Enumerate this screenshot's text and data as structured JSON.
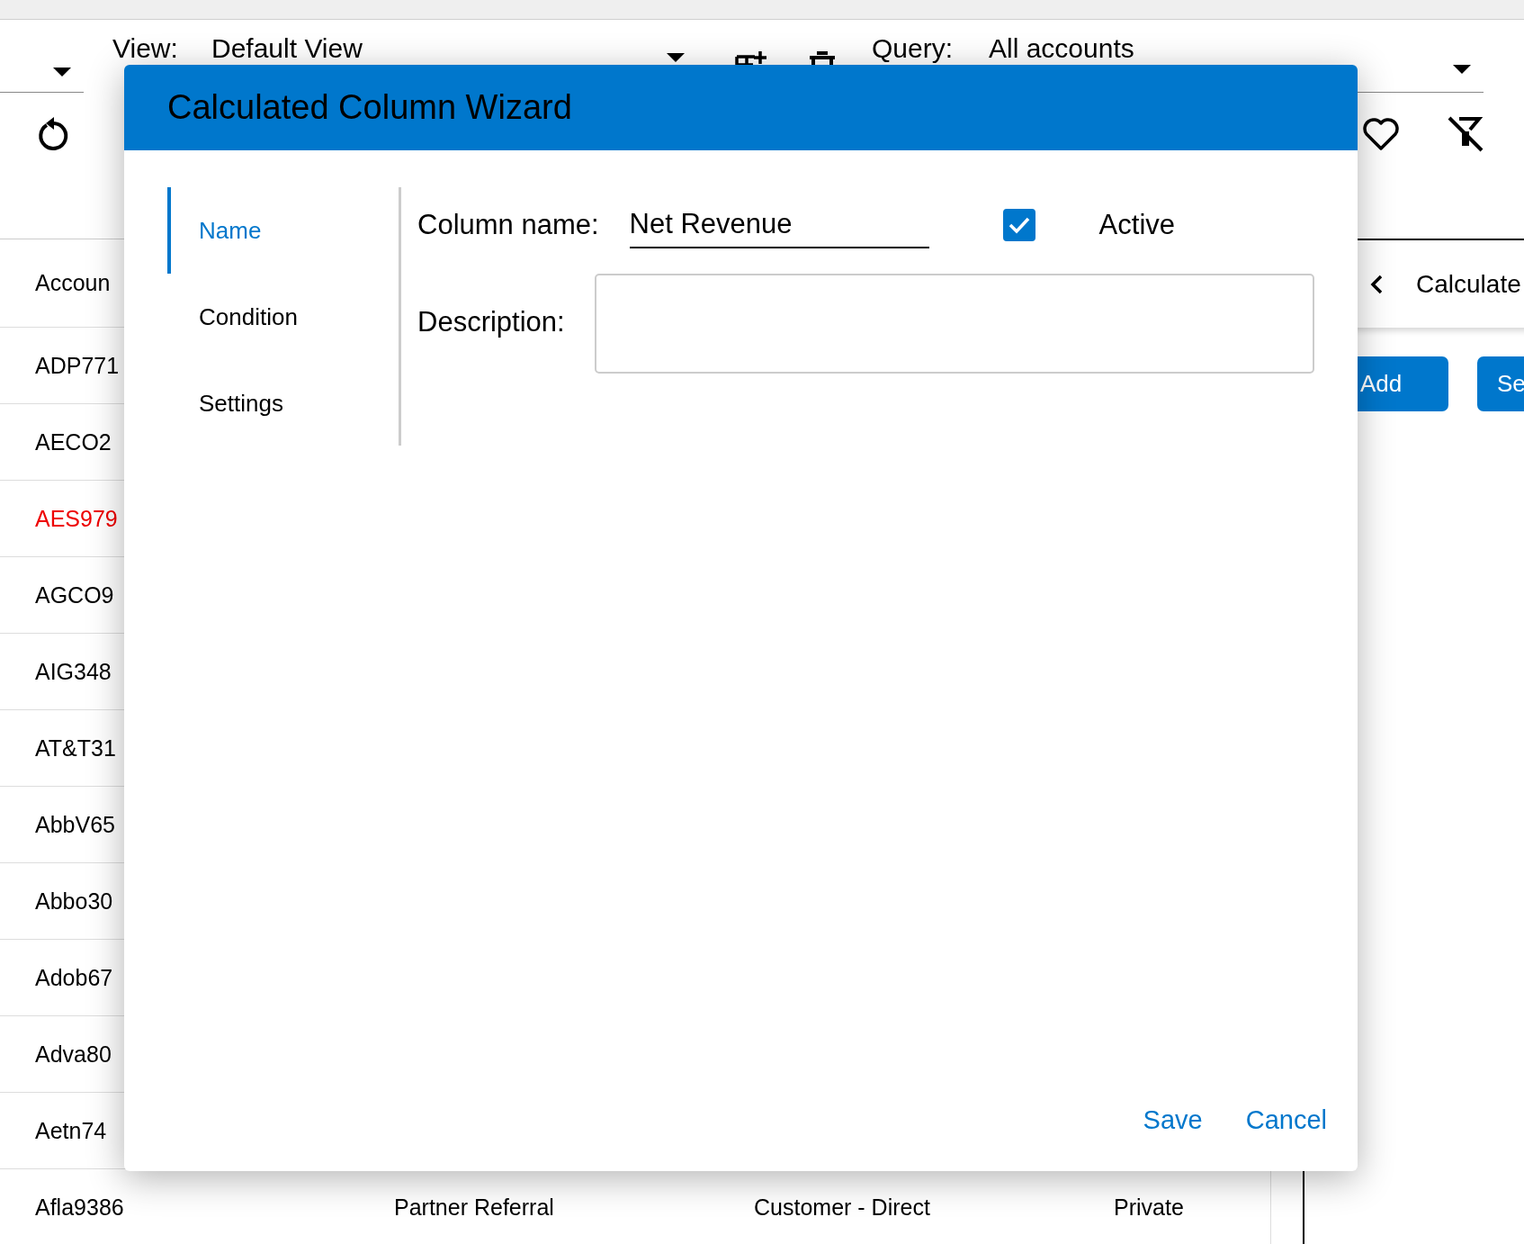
{
  "toolbar": {
    "view_label": "View:",
    "view_value": "Default View",
    "query_label": "Query:",
    "query_value": "All accounts"
  },
  "table": {
    "columns": [
      "Accoun"
    ],
    "rows": [
      {
        "cells": [
          "ADP771"
        ],
        "color": "#000000"
      },
      {
        "cells": [
          "AECO2"
        ],
        "color": "#000000"
      },
      {
        "cells": [
          "AES979"
        ],
        "color": "#ee0000"
      },
      {
        "cells": [
          "AGCO9"
        ],
        "color": "#000000"
      },
      {
        "cells": [
          "AIG348"
        ],
        "color": "#000000"
      },
      {
        "cells": [
          "AT&T31"
        ],
        "color": "#000000"
      },
      {
        "cells": [
          "AbbV65"
        ],
        "color": "#000000"
      },
      {
        "cells": [
          "Abbo30"
        ],
        "color": "#000000"
      },
      {
        "cells": [
          "Adob67"
        ],
        "color": "#000000"
      },
      {
        "cells": [
          "Adva80"
        ],
        "color": "#000000"
      },
      {
        "cells": [
          "Aetn74"
        ],
        "color": "#000000"
      },
      {
        "cells": [
          "Afla9386",
          "Partner Referral",
          "Customer - Direct",
          "Private"
        ],
        "color": "#000000"
      }
    ]
  },
  "side_panel": {
    "title": "Calculate",
    "buttons": [
      "Add",
      "Se"
    ]
  },
  "dialog": {
    "title": "Calculated Column Wizard",
    "steps": [
      {
        "label": "Name",
        "selected": true
      },
      {
        "label": "Condition",
        "selected": false
      },
      {
        "label": "Settings",
        "selected": false
      }
    ],
    "column_name": {
      "label": "Column name:",
      "value": "Net Revenue"
    },
    "active": {
      "label": "Active",
      "checked": true
    },
    "description": {
      "label": "Description:"
    },
    "buttons": [
      "Save",
      "Cancel"
    ]
  }
}
